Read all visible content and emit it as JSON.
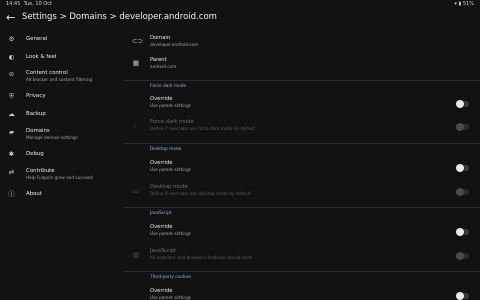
{
  "status": {
    "time": "14:45",
    "date": "Tue, 10 Oct",
    "battery": "51%"
  },
  "appbar": {
    "title": "Settings > Domains > developer.android.com"
  },
  "sidebar": {
    "items": [
      {
        "label": "General",
        "icon": "gear-icon"
      },
      {
        "label": "Look & feel",
        "icon": "palette-icon"
      },
      {
        "label": "Content control",
        "sub": "Ad blocker and content filtering",
        "icon": "block-icon"
      },
      {
        "label": "Privacy",
        "icon": "shield-icon"
      },
      {
        "label": "Backup",
        "icon": "backup-icon"
      },
      {
        "label": "Domains",
        "sub": "Manage domain settings",
        "icon": "folder-icon"
      },
      {
        "label": "Debug",
        "icon": "bug-icon"
      },
      {
        "label": "Contribute",
        "sub": "Help Fulguris grow and succeed",
        "icon": "contribute-icon"
      },
      {
        "label": "About",
        "icon": "info-icon"
      }
    ]
  },
  "main": {
    "domain": {
      "label": "Domain",
      "value": "developer.android.com"
    },
    "parent": {
      "label": "Parent",
      "value": "android.com"
    },
    "sections": [
      {
        "header": "Force dark mode",
        "override": {
          "label": "Override",
          "sub": "Use parent settings"
        },
        "setting": {
          "label": "Force dark mode",
          "sub": "Define if new tabs use force dark mode by default"
        }
      },
      {
        "header": "Desktop mode",
        "override": {
          "label": "Override",
          "sub": "Use parent settings"
        },
        "setting": {
          "label": "Desktop mode",
          "sub": "Define if new tabs use desktop mode by default"
        }
      },
      {
        "header": "JavaScript",
        "override": {
          "label": "Override",
          "sub": "Use parent settings"
        },
        "setting": {
          "label": "JavaScript",
          "sub": "All websites' and browser's features should work"
        }
      },
      {
        "header": "Third-party cookies",
        "override": {
          "label": "Override",
          "sub": "Use parent settings"
        }
      }
    ]
  }
}
